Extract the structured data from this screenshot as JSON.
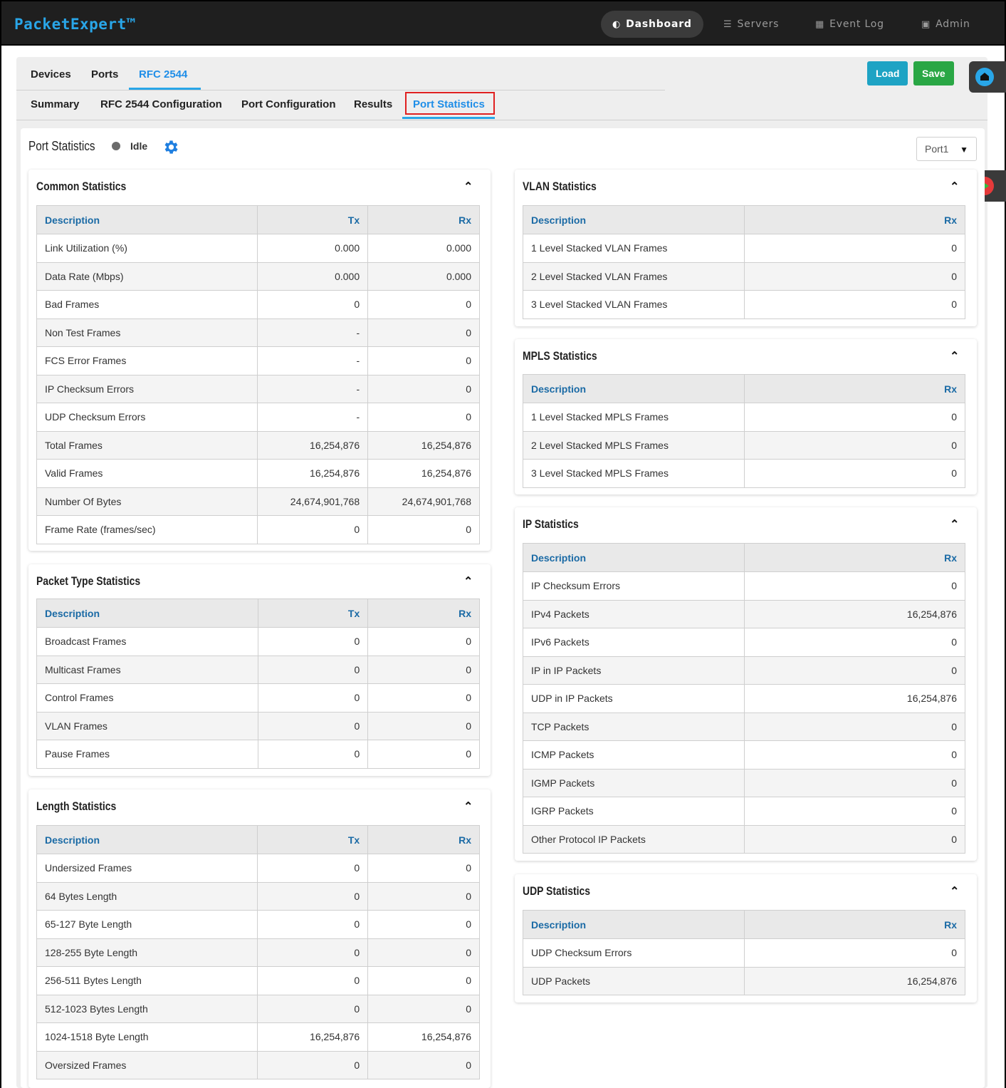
{
  "app": {
    "brand": "PacketExpert™",
    "nav": [
      {
        "label": "Dashboard",
        "icon": "dashboard-icon",
        "glyph": "◐",
        "active": true
      },
      {
        "label": "Servers",
        "icon": "servers-icon",
        "glyph": "☰",
        "active": false
      },
      {
        "label": "Event Log",
        "icon": "calendar-icon",
        "glyph": "▦",
        "active": false
      },
      {
        "label": "Admin",
        "icon": "admin-icon",
        "glyph": "▣",
        "active": false
      }
    ]
  },
  "tabs_top": [
    {
      "label": "Devices",
      "active": false
    },
    {
      "label": "Ports",
      "active": false
    },
    {
      "label": "RFC 2544",
      "active": true
    }
  ],
  "tabs_sub": [
    {
      "label": "Summary",
      "active": false
    },
    {
      "label": "RFC 2544 Configuration",
      "active": false
    },
    {
      "label": "Port Configuration",
      "active": false
    },
    {
      "label": "Results",
      "active": false
    },
    {
      "label": "Port Statistics",
      "active": true
    }
  ],
  "toolbar": {
    "load_label": "Load",
    "save_label": "Save"
  },
  "header": {
    "title": "Port Statistics",
    "status": "Idle",
    "port_selected": "Port1"
  },
  "colors": {
    "accent": "#1f8ee8",
    "load": "#1ea3c4",
    "save": "#2aa745",
    "highlight": "#e02020"
  },
  "common": {
    "title": "Common Statistics",
    "cols": [
      "Description",
      "Tx",
      "Rx"
    ],
    "rows": [
      [
        "Link Utilization (%)",
        "0.000",
        "0.000"
      ],
      [
        "Data Rate (Mbps)",
        "0.000",
        "0.000"
      ],
      [
        "Bad Frames",
        "0",
        "0"
      ],
      [
        "Non Test Frames",
        "-",
        "0"
      ],
      [
        "FCS Error Frames",
        "-",
        "0"
      ],
      [
        "IP Checksum Errors",
        "-",
        "0"
      ],
      [
        "UDP Checksum Errors",
        "-",
        "0"
      ],
      [
        "Total Frames",
        "16,254,876",
        "16,254,876"
      ],
      [
        "Valid Frames",
        "16,254,876",
        "16,254,876"
      ],
      [
        "Number Of Bytes",
        "24,674,901,768",
        "24,674,901,768"
      ],
      [
        "Frame Rate (frames/sec)",
        "0",
        "0"
      ]
    ]
  },
  "packet": {
    "title": "Packet Type Statistics",
    "cols": [
      "Description",
      "Tx",
      "Rx"
    ],
    "rows": [
      [
        "Broadcast Frames",
        "0",
        "0"
      ],
      [
        "Multicast Frames",
        "0",
        "0"
      ],
      [
        "Control Frames",
        "0",
        "0"
      ],
      [
        "VLAN Frames",
        "0",
        "0"
      ],
      [
        "Pause Frames",
        "0",
        "0"
      ]
    ]
  },
  "length": {
    "title": "Length Statistics",
    "cols": [
      "Description",
      "Tx",
      "Rx"
    ],
    "rows": [
      [
        "Undersized Frames",
        "0",
        "0"
      ],
      [
        "64 Bytes Length",
        "0",
        "0"
      ],
      [
        "65-127 Byte Length",
        "0",
        "0"
      ],
      [
        "128-255 Byte Length",
        "0",
        "0"
      ],
      [
        "256-511 Bytes Length",
        "0",
        "0"
      ],
      [
        "512-1023 Bytes Length",
        "0",
        "0"
      ],
      [
        "1024-1518 Byte Length",
        "16,254,876",
        "16,254,876"
      ],
      [
        "Oversized Frames",
        "0",
        "0"
      ]
    ]
  },
  "vlan": {
    "title": "VLAN Statistics",
    "cols": [
      "Description",
      "Rx"
    ],
    "rows": [
      [
        "1 Level Stacked VLAN Frames",
        "0"
      ],
      [
        "2 Level Stacked VLAN Frames",
        "0"
      ],
      [
        "3 Level Stacked VLAN Frames",
        "0"
      ]
    ]
  },
  "mpls": {
    "title": "MPLS Statistics",
    "cols": [
      "Description",
      "Rx"
    ],
    "rows": [
      [
        "1 Level Stacked MPLS Frames",
        "0"
      ],
      [
        "2 Level Stacked MPLS Frames",
        "0"
      ],
      [
        "3 Level Stacked MPLS Frames",
        "0"
      ]
    ]
  },
  "ip": {
    "title": "IP Statistics",
    "cols": [
      "Description",
      "Rx"
    ],
    "rows": [
      [
        "IP Checksum Errors",
        "0"
      ],
      [
        "IPv4 Packets",
        "16,254,876"
      ],
      [
        "IPv6 Packets",
        "0"
      ],
      [
        "IP in IP Packets",
        "0"
      ],
      [
        "UDP in IP Packets",
        "16,254,876"
      ],
      [
        "TCP Packets",
        "0"
      ],
      [
        "ICMP Packets",
        "0"
      ],
      [
        "IGMP Packets",
        "0"
      ],
      [
        "IGRP Packets",
        "0"
      ],
      [
        "Other Protocol IP Packets",
        "0"
      ]
    ]
  },
  "udp": {
    "title": "UDP Statistics",
    "cols": [
      "Description",
      "Rx"
    ],
    "rows": [
      [
        "UDP Checksum Errors",
        "0"
      ],
      [
        "UDP Packets",
        "16,254,876"
      ]
    ]
  }
}
